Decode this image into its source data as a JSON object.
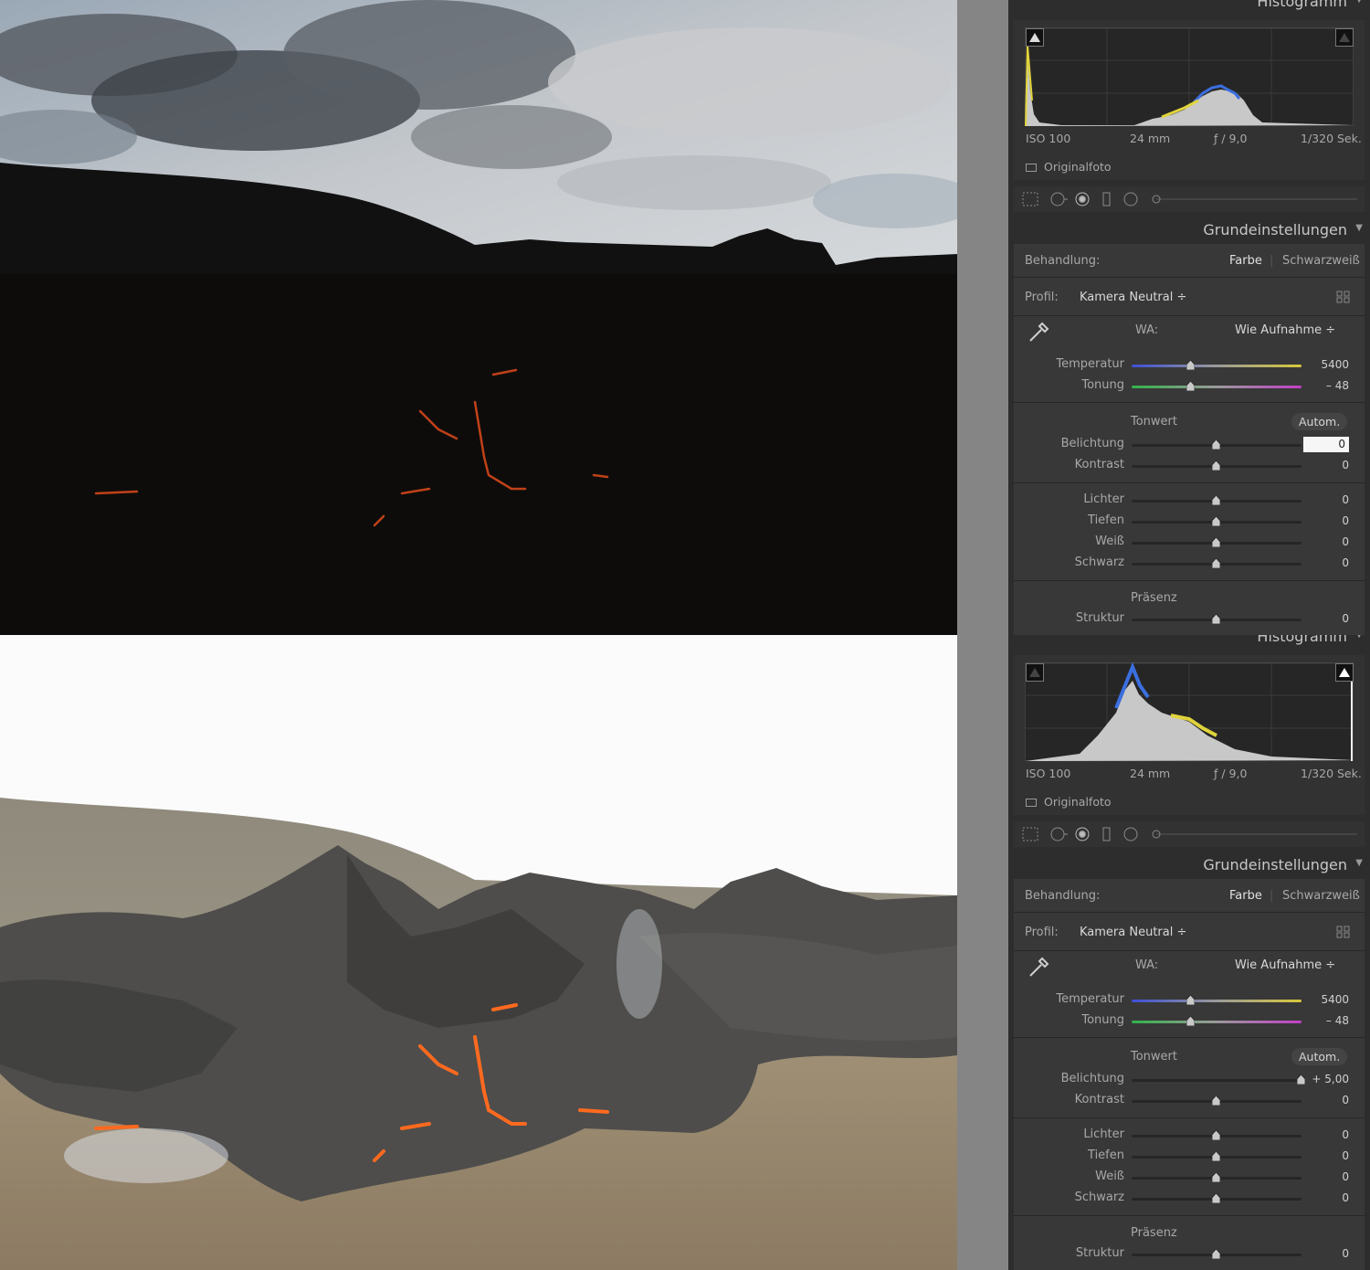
{
  "panels": [
    {
      "histogram": {
        "title": "Histogramm",
        "iso": "ISO 100",
        "focal": "24 mm",
        "aperture": "ƒ / 9,0",
        "shutter": "1/320 Sek.",
        "original_label": "Originalfoto"
      },
      "basic": {
        "title": "Grundeinstellungen",
        "behandlung_label": "Behandlung:",
        "farbe": "Farbe",
        "schwarzweiss": "Schwarzweiß",
        "profil_label": "Profil:",
        "profil_value": "Kamera Neutral ÷",
        "wa_label": "WA:",
        "wa_value": "Wie Aufnahme ÷",
        "temperatur_label": "Temperatur",
        "temperatur_value": "5400",
        "tonung_label": "Tonung",
        "tonung_value": "– 48",
        "tonwert_label": "Tonwert",
        "autom_label": "Autom.",
        "belichtung_label": "Belichtung",
        "belichtung_value": "0",
        "kontrast_label": "Kontrast",
        "kontrast_value": "0",
        "lichter_label": "Lichter",
        "lichter_value": "0",
        "tiefen_label": "Tiefen",
        "tiefen_value": "0",
        "weiss_label": "Weiß",
        "weiss_value": "0",
        "schwarz_label": "Schwarz",
        "schwarz_value": "0",
        "praesenz_label": "Präsenz",
        "struktur_label": "Struktur",
        "struktur_value": "0"
      },
      "slider_levels": {
        "temperatur": 0.35,
        "tonung": 0.35,
        "belichtung": 0.5,
        "kontrast": 0.5,
        "lichter": 0.5,
        "tiefen": 0.5,
        "weiss": 0.5,
        "schwarz": 0.5,
        "struktur": 0.5
      }
    },
    {
      "histogram": {
        "title": "Histogramm",
        "iso": "ISO 100",
        "focal": "24 mm",
        "aperture": "ƒ / 9,0",
        "shutter": "1/320 Sek.",
        "original_label": "Originalfoto"
      },
      "basic": {
        "title": "Grundeinstellungen",
        "behandlung_label": "Behandlung:",
        "farbe": "Farbe",
        "schwarzweiss": "Schwarzweiß",
        "profil_label": "Profil:",
        "profil_value": "Kamera Neutral ÷",
        "wa_label": "WA:",
        "wa_value": "Wie Aufnahme ÷",
        "temperatur_label": "Temperatur",
        "temperatur_value": "5400",
        "tonung_label": "Tonung",
        "tonung_value": "– 48",
        "tonwert_label": "Tonwert",
        "autom_label": "Autom.",
        "belichtung_label": "Belichtung",
        "belichtung_value": "+ 5,00",
        "kontrast_label": "Kontrast",
        "kontrast_value": "0",
        "lichter_label": "Lichter",
        "lichter_value": "0",
        "tiefen_label": "Tiefen",
        "tiefen_value": "0",
        "weiss_label": "Weiß",
        "weiss_value": "0",
        "schwarz_label": "Schwarz",
        "schwarz_value": "0",
        "praesenz_label": "Präsenz",
        "struktur_label": "Struktur",
        "struktur_value": "0"
      },
      "slider_levels": {
        "temperatur": 0.35,
        "tonung": 0.35,
        "belichtung": 1.0,
        "kontrast": 0.5,
        "lichter": 0.5,
        "tiefen": 0.5,
        "weiss": 0.5,
        "schwarz": 0.5,
        "struktur": 0.5
      }
    }
  ],
  "icons": {
    "tools": [
      "crop-grid-icon",
      "spot-removal-icon",
      "redeye-icon",
      "graduated-filter-icon",
      "radial-filter-icon",
      "brush-slider-icon"
    ],
    "eyedropper": "eyedropper-icon",
    "profile_grid": "profile-browser-icon"
  }
}
